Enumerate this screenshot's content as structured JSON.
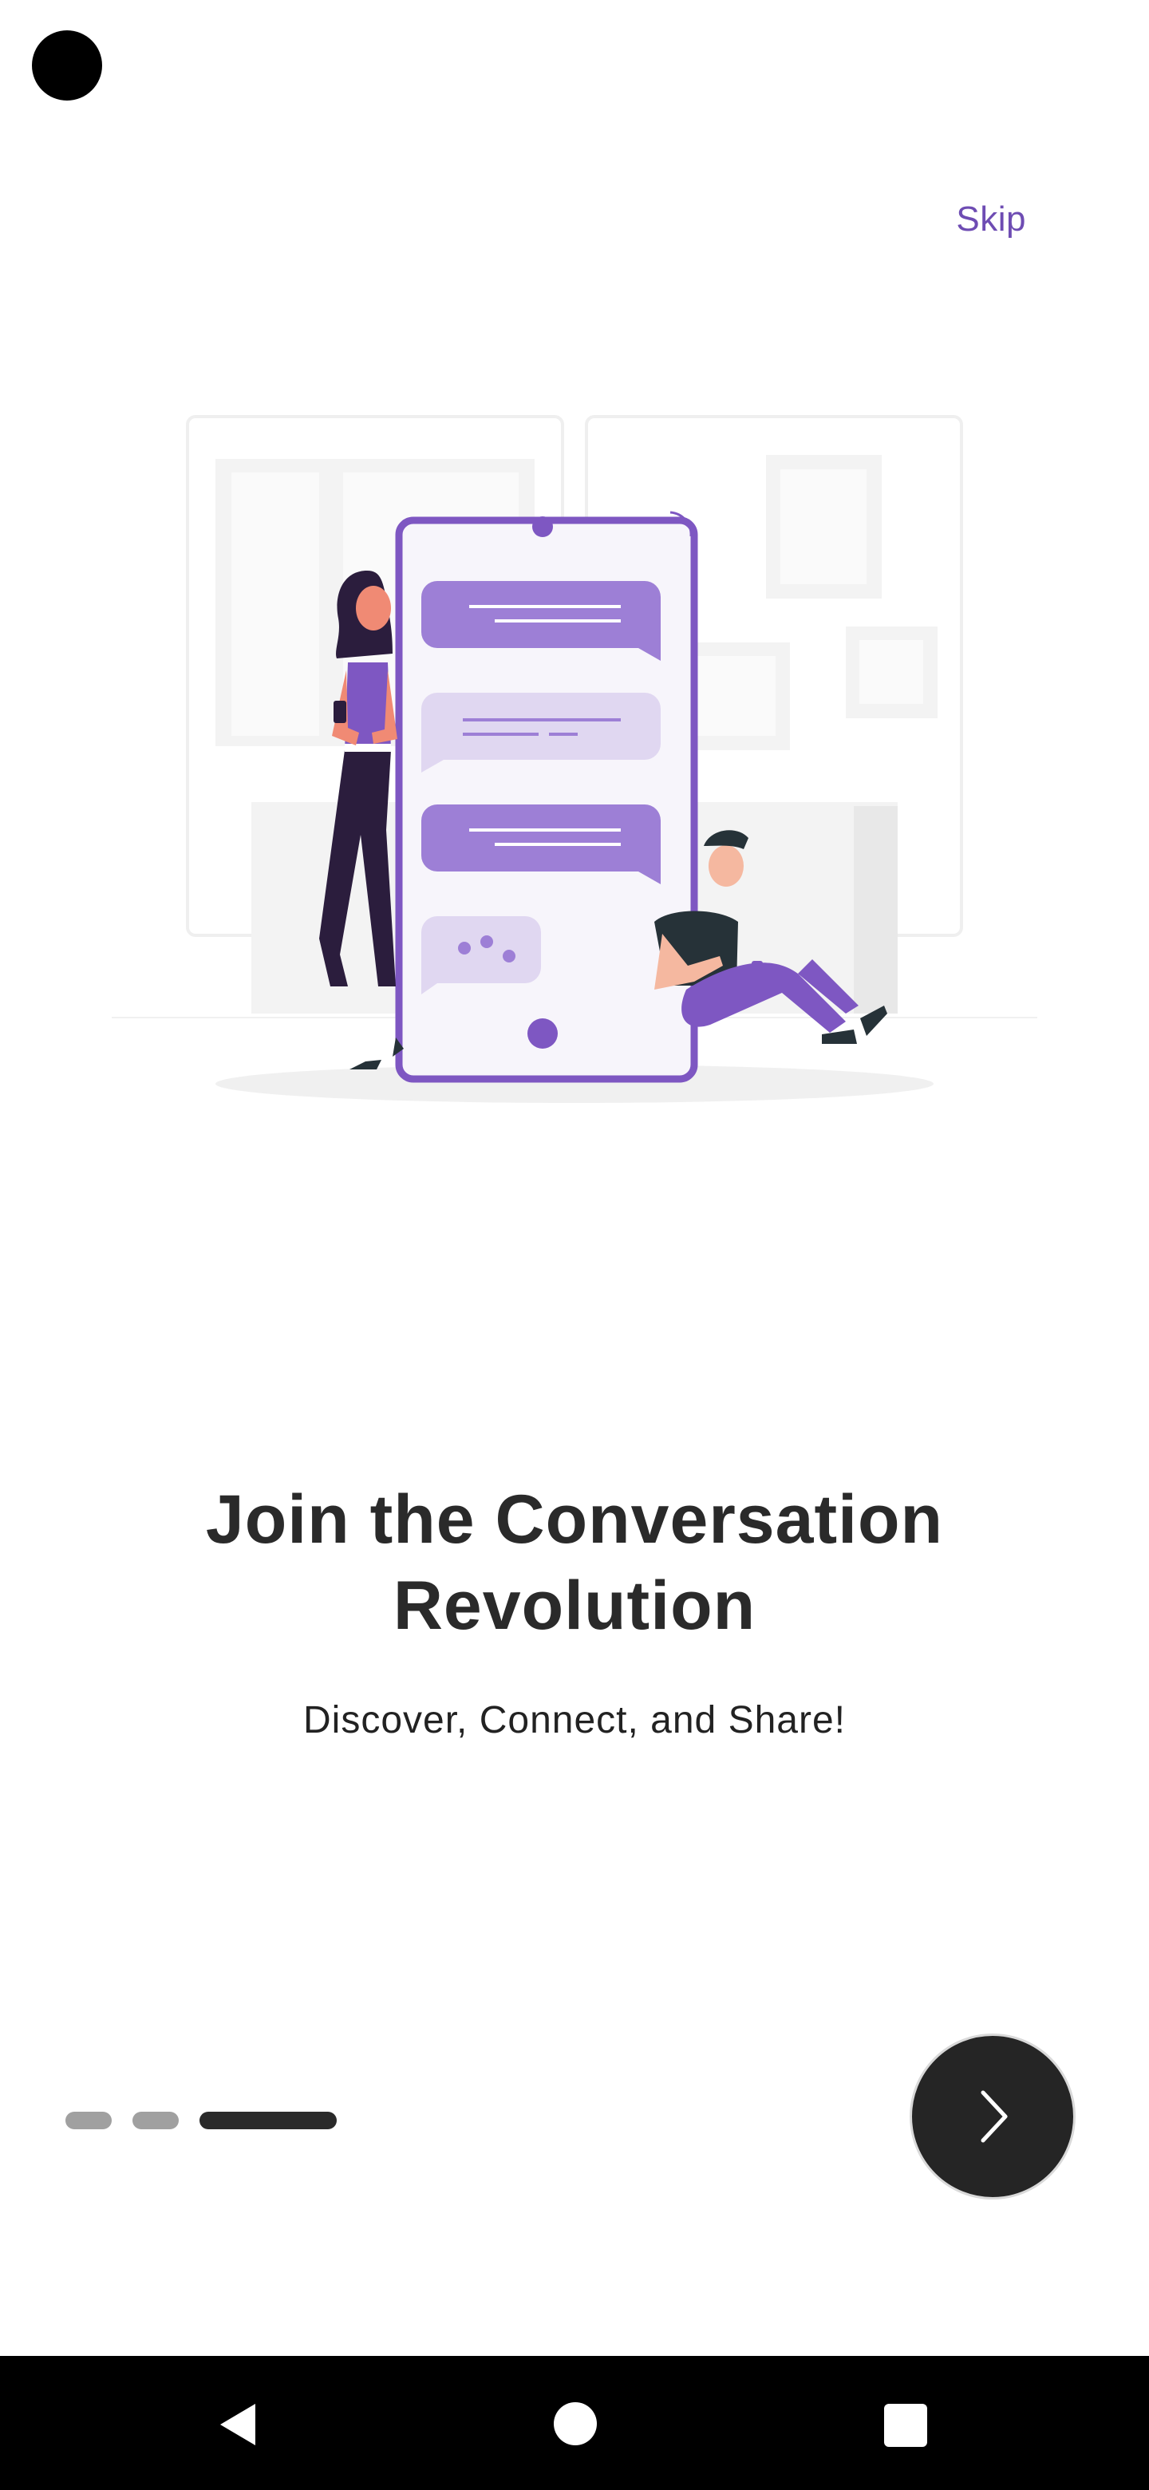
{
  "onboarding": {
    "skip_label": "Skip",
    "title_line1": "Join the Conversation",
    "title_line2": "Revolution",
    "subtitle": "Discover, Connect, and Share!",
    "page_indicator": {
      "total": 3,
      "current": 3
    },
    "next_icon": "chevron-right-icon"
  },
  "colors": {
    "accent": "#7e57c2",
    "accent_light": "#b39ddb",
    "title": "#2a2a2a",
    "indicator_inactive": "#a0a0a0",
    "indicator_active": "#2a2a2a",
    "button_bg": "#252525"
  },
  "system_nav": {
    "back_icon": "back-triangle-icon",
    "home_icon": "home-circle-icon",
    "recents_icon": "recents-square-icon"
  }
}
